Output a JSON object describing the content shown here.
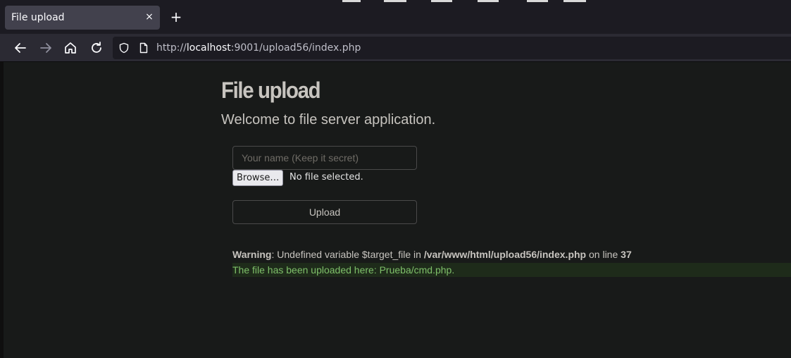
{
  "browser": {
    "tab_title": "File upload",
    "tab_close": "×",
    "new_tab": "+",
    "url_scheme": "http://",
    "url_host": "localhost",
    "url_rest": ":9001/upload56/index.php"
  },
  "page": {
    "heading": "File upload",
    "lead": "Welcome to file server application.",
    "name_placeholder": "Your name (Keep it secret)",
    "browse_label": "Browse…",
    "file_status": "No file selected.",
    "upload_label": "Upload",
    "warning": {
      "label": "Warning",
      "text1": ": Undefined variable $target_file in ",
      "path": "/var/www/html/upload56/index.php",
      "text2": " on line ",
      "line": "37"
    },
    "success_message": "The file has been uploaded here: Prueba/cmd.php."
  },
  "colors": {
    "page_bg": "#181a19",
    "success_bg": "#1e2b1a",
    "success_text": "#7fc06a"
  }
}
